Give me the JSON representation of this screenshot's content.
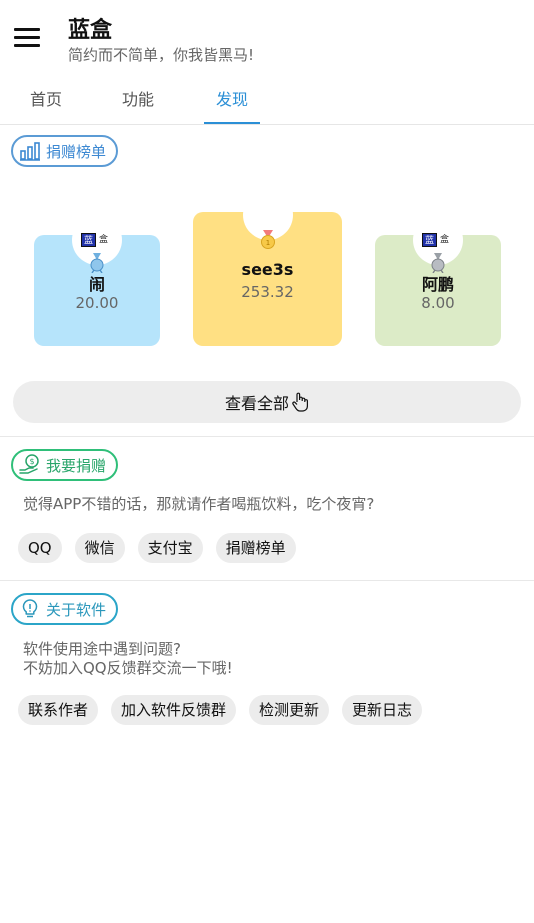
{
  "header": {
    "title": "蓝盒",
    "subtitle": "简约而不简单，你我皆黑马!"
  },
  "tabs": [
    {
      "label": "首页"
    },
    {
      "label": "功能"
    },
    {
      "label": "发现",
      "active": true
    }
  ],
  "donation_ranking": {
    "title": "捐赠榜单",
    "donors": [
      {
        "rank": 1,
        "name": "see3s",
        "amount": "253.32"
      },
      {
        "rank": 2,
        "name": "闹",
        "amount": "20.00"
      },
      {
        "rank": 3,
        "name": "阿鹏",
        "amount": "8.00"
      }
    ],
    "view_all": "查看全部"
  },
  "donate": {
    "title": "我要捐赠",
    "description": "觉得APP不错的话，那就请作者喝瓶饮料，吃个夜宵?",
    "options": [
      "QQ",
      "微信",
      "支付宝",
      "捐赠榜单"
    ]
  },
  "about": {
    "title": "关于软件",
    "description_line1": "软件使用途中遇到问题?",
    "description_line2": "不妨加入QQ反馈群交流一下哦!",
    "options": [
      "联系作者",
      "加入软件反馈群",
      "检测更新",
      "更新日志"
    ]
  },
  "colors": {
    "accent": "#2b8fd6",
    "first_place": "#ffe083",
    "second_place": "#b6e4fb",
    "third_place": "#dcebc7"
  }
}
